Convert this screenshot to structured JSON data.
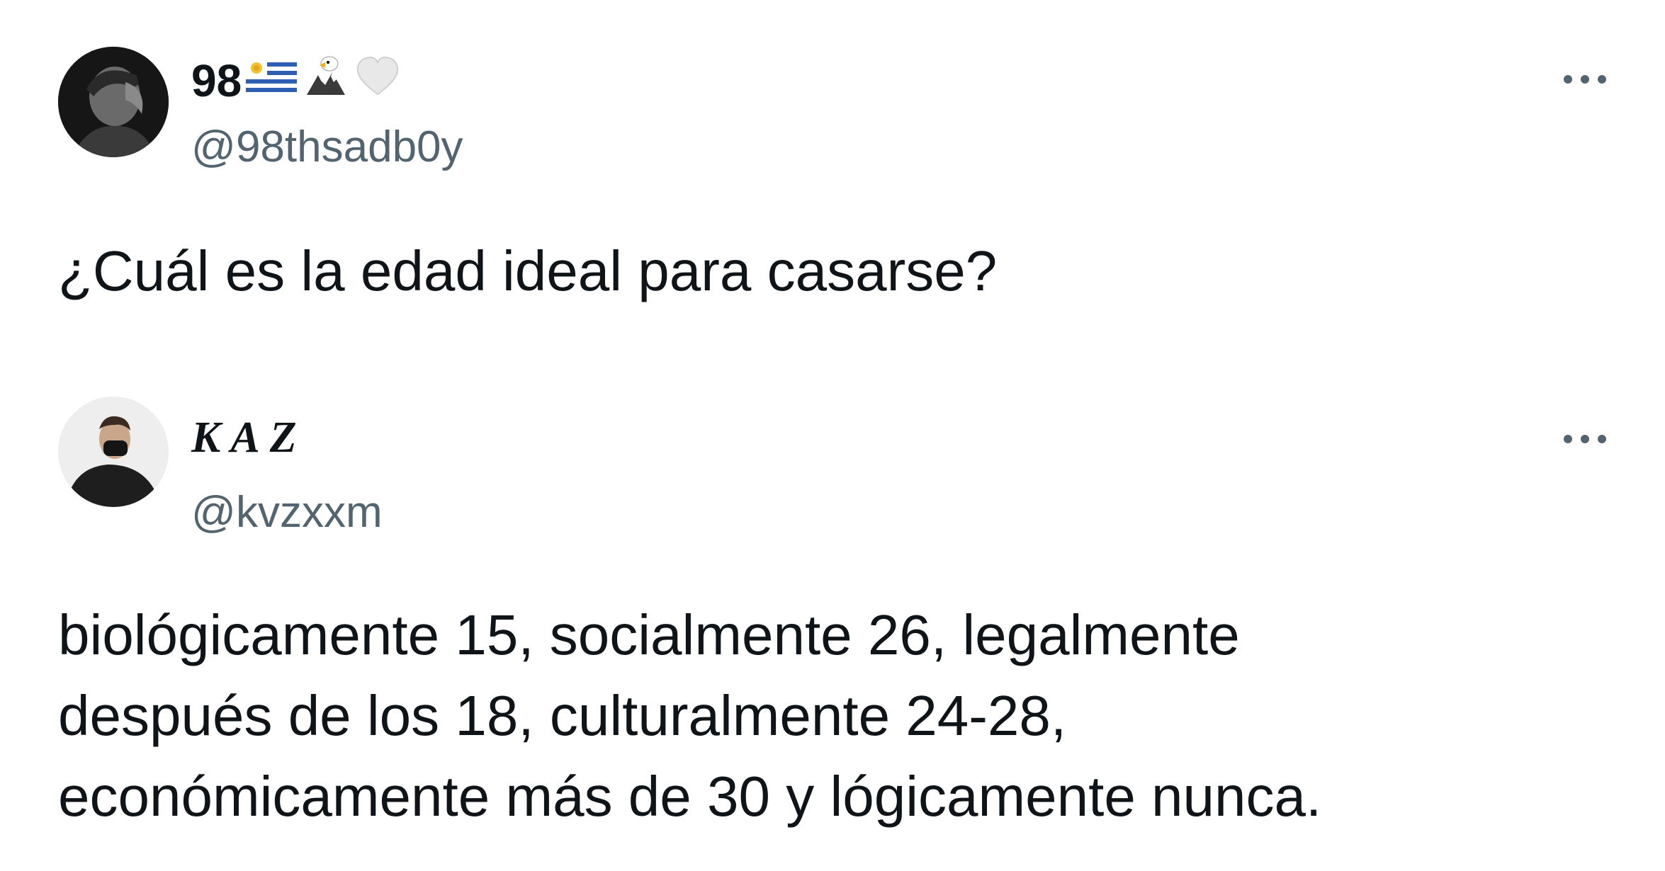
{
  "tweets": [
    {
      "display_name": "98",
      "emoji_flag": "uruguay-flag-icon",
      "emoji_1": "eagle-icon",
      "emoji_2": "white-heart-icon",
      "handle": "@98thsadb0y",
      "text": "¿Cuál es la edad ideal para casarse?"
    },
    {
      "display_name": "KAZ",
      "handle": "@kvzxxm",
      "text_lines": [
        "biológicamente 15, socialmente 26, legalmente",
        "después de los 18, culturalmente 24-28,",
        "económicamente más de 30 y lógicamente nunca."
      ]
    }
  ],
  "colors": {
    "text": "#0f1419",
    "secondary": "#536471",
    "background": "#ffffff"
  }
}
